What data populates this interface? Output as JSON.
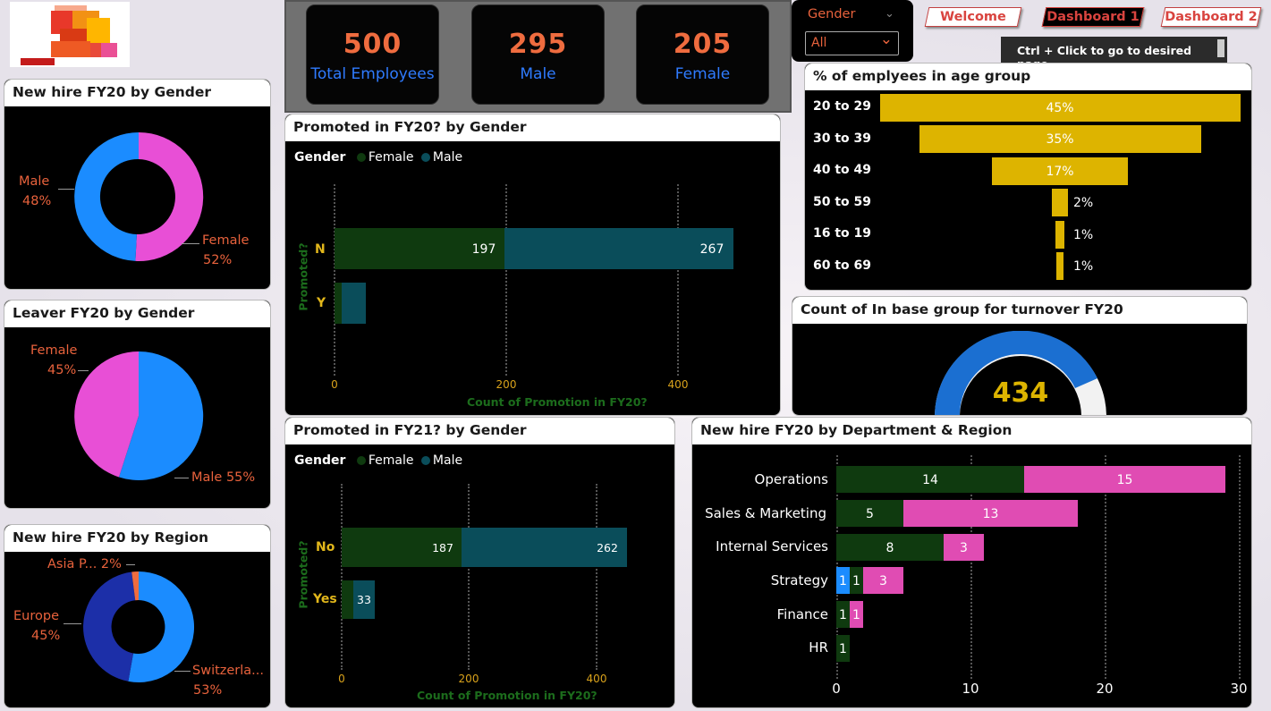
{
  "nav": {
    "welcome": "Welcome",
    "dashboard1": "Dashboard 1",
    "dashboard2": "Dashboard 2",
    "hint": "Ctrl + Click to go to desired page."
  },
  "filter": {
    "label": "Gender",
    "value": "All"
  },
  "kpis": [
    {
      "value": "500",
      "label": "Total Employees"
    },
    {
      "value": "295",
      "label": "Male"
    },
    {
      "value": "205",
      "label": "Female"
    }
  ],
  "colors": {
    "female_pink": "#e84fd6",
    "male_blue": "#1b8cff",
    "female_green": "#0f3a0f",
    "male_teal": "#0a4d5a",
    "gold": "#ddb400",
    "orange": "#ef6c3f"
  },
  "new_hire_gender": {
    "title": "New hire FY20 by Gender",
    "male_label": "Male",
    "male_pct": "48%",
    "female_label": "Female",
    "female_pct": "52%"
  },
  "leaver_gender": {
    "title": "Leaver FY20 by Gender",
    "female_label": "Female",
    "female_pct": "45%",
    "male_label": "Male 55%"
  },
  "new_hire_region": {
    "title": "New hire FY20 by Region",
    "asia_label": "Asia P... 2%",
    "europe_label": "Europe",
    "europe_pct": "45%",
    "swiss_label": "Switzerla...",
    "swiss_pct": "53%"
  },
  "promoted_fy20": {
    "title": "Promoted in FY20? by Gender",
    "legend_title": "Gender",
    "legend_female": "Female",
    "legend_male": "Male",
    "cat_n": "N",
    "cat_y": "Y",
    "n_female": "197",
    "n_male": "267",
    "ytitle": "Promoted?",
    "xtitle": "Count of Promotion in FY20?",
    "ticks": [
      "0",
      "200",
      "400"
    ]
  },
  "promoted_fy21": {
    "title": "Promoted in FY21? by Gender",
    "legend_title": "Gender",
    "legend_female": "Female",
    "legend_male": "Male",
    "cat_no": "No",
    "cat_yes": "Yes",
    "no_female": "187",
    "no_male": "262",
    "yes_male": "33",
    "ytitle": "Promoted?",
    "xtitle": "Count of Promotion in FY20?",
    "ticks": [
      "0",
      "200",
      "400"
    ]
  },
  "age_group": {
    "title": "% of emplyees in age group",
    "rows": [
      {
        "cat": "20 to 29",
        "pct": "45%"
      },
      {
        "cat": "30 to 39",
        "pct": "35%"
      },
      {
        "cat": "40 to 49",
        "pct": "17%"
      },
      {
        "cat": "50 to 59",
        "pct": "2%"
      },
      {
        "cat": "16 to 19",
        "pct": "1%"
      },
      {
        "cat": "60 to 69",
        "pct": "1%"
      }
    ]
  },
  "turnover": {
    "title": "Count of In base group for turnover FY20",
    "value": "434"
  },
  "dept_region": {
    "title": "New hire FY20 by Department & Region",
    "rows": [
      {
        "cat": "Operations",
        "labels": [
          "14",
          "15"
        ]
      },
      {
        "cat": "Sales & Marketing",
        "labels": [
          "5",
          "13"
        ]
      },
      {
        "cat": "Internal Services",
        "labels": [
          "8",
          "3"
        ]
      },
      {
        "cat": "Strategy",
        "labels": [
          "1",
          "1",
          "3"
        ]
      },
      {
        "cat": "Finance",
        "labels": [
          "1",
          "1"
        ]
      },
      {
        "cat": "HR",
        "labels": [
          "1"
        ]
      }
    ],
    "ticks": [
      "0",
      "10",
      "20",
      "30"
    ]
  },
  "chart_data": [
    {
      "type": "pie",
      "title": "New hire FY20 by Gender",
      "labels": [
        "Male",
        "Female"
      ],
      "values": [
        48,
        52
      ]
    },
    {
      "type": "pie",
      "title": "Leaver FY20 by Gender",
      "labels": [
        "Female",
        "Male"
      ],
      "values": [
        45,
        55
      ]
    },
    {
      "type": "pie",
      "title": "New hire FY20 by Region",
      "labels": [
        "Asia P...",
        "Europe",
        "Switzerla..."
      ],
      "values": [
        2,
        45,
        53
      ]
    },
    {
      "type": "bar",
      "title": "Promoted in FY20? by Gender",
      "categories": [
        "N",
        "Y"
      ],
      "series": [
        {
          "name": "Female",
          "values": [
            197,
            8
          ]
        },
        {
          "name": "Male",
          "values": [
            267,
            28
          ]
        }
      ],
      "xlabel": "Count of Promotion in FY20?",
      "ylabel": "Promoted?"
    },
    {
      "type": "bar",
      "title": "Promoted in FY21? by Gender",
      "categories": [
        "No",
        "Yes"
      ],
      "series": [
        {
          "name": "Female",
          "values": [
            187,
            18
          ]
        },
        {
          "name": "Male",
          "values": [
            262,
            33
          ]
        }
      ],
      "xlabel": "Count of Promotion in FY20?",
      "ylabel": "Promoted?"
    },
    {
      "type": "bar",
      "title": "% of emplyees in age group",
      "categories": [
        "20 to 29",
        "30 to 39",
        "40 to 49",
        "50 to 59",
        "16 to 19",
        "60 to 69"
      ],
      "values": [
        45,
        35,
        17,
        2,
        1,
        1
      ]
    },
    {
      "type": "bar",
      "title": "New hire FY20 by Department & Region",
      "categories": [
        "Operations",
        "Sales & Marketing",
        "Internal Services",
        "Strategy",
        "Finance",
        "HR"
      ],
      "series": [
        {
          "values": [
            0,
            0,
            0,
            1,
            0,
            0
          ]
        },
        {
          "values": [
            14,
            5,
            8,
            1,
            1,
            1
          ]
        },
        {
          "values": [
            15,
            13,
            3,
            3,
            1,
            0
          ]
        }
      ],
      "xlim": [
        0,
        30
      ]
    }
  ]
}
